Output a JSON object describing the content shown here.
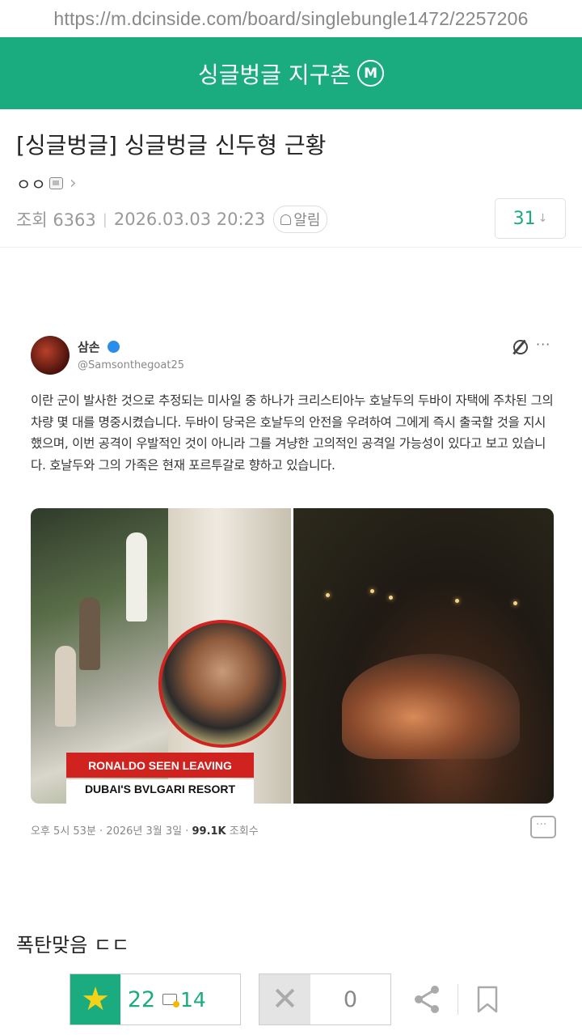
{
  "url": "https://m.dcinside.com/board/singlebungle1472/2257206",
  "gallery": {
    "name": "싱글벙글 지구촌",
    "badge": "M"
  },
  "post": {
    "title": "[싱글벙글] 싱글벙글 신두형 근황",
    "author": "ㅇㅇ",
    "views_label": "조회 6363",
    "date": "2026.03.03 20:23",
    "alarm_label": "알림",
    "comment_count": "31",
    "body_text": "폭탄맞음 ㄷㄷ"
  },
  "tweet": {
    "name": "삼손",
    "handle": "@Samsonthegoat25",
    "text": "이란 군이 발사한 것으로 추정되는 미사일 중 하나가 크리스티아누 호날두의 두바이 자택에 주차된 그의 차량 몇 대를 명중시켰습니다. 두바이 당국은 호날두의 안전을 우려하여 그에게 즉시 출국할 것을 지시했으며, 이번 공격이 우발적인 것이 아니라 그를 겨냥한 고의적인 공격일 가능성이 있다고 보고 있습니다. 호날두와 그의 가족은 현재 포르투갈로 향하고 있습니다.",
    "banner_line1": "RONALDO SEEN LEAVING",
    "banner_line2": "DUBAI'S BVLGARI RESORT",
    "footer_time": "오후 5시 53분 · 2026년 3월 3일 · ",
    "footer_views": "99.1K",
    "footer_views_label": " 조회수"
  },
  "votes": {
    "up": "22",
    "fix": "14",
    "down": "0"
  },
  "icons": [
    "gallery-icon",
    "chevron-right-icon",
    "bell-icon",
    "star-icon",
    "close-icon",
    "share-icon",
    "bookmark-icon",
    "grok-icon",
    "more-icon",
    "reply-icon"
  ],
  "colors": {
    "brand": "#1aab7e",
    "star": "#f5d21a",
    "banner": "#d0231f"
  }
}
